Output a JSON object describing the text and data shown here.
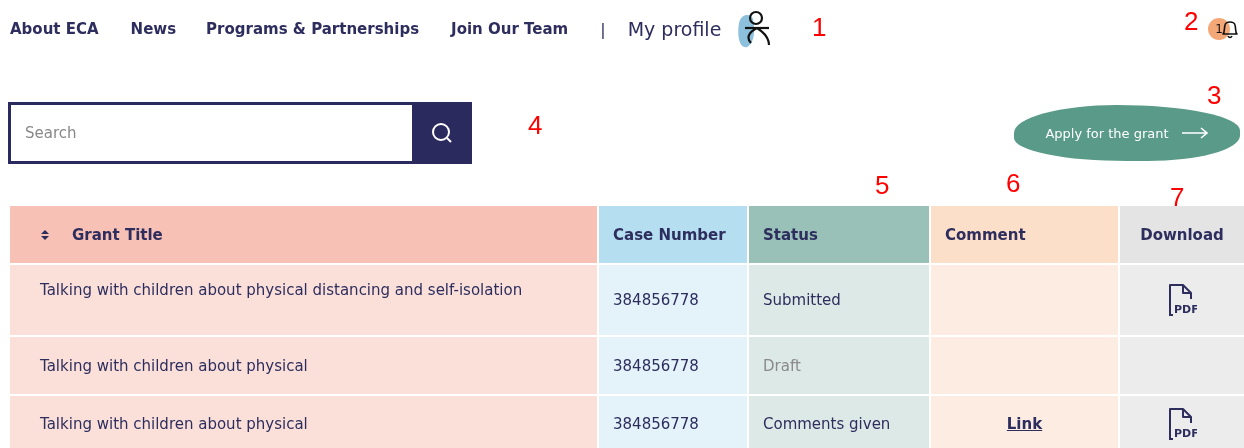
{
  "nav": {
    "links": [
      "About ECA",
      "News",
      "Programs & Partnerships",
      "Join Our Team"
    ],
    "separator": "|",
    "profile": "My profile"
  },
  "notifications": {
    "count": "1"
  },
  "search": {
    "placeholder": "Search"
  },
  "apply_button": {
    "label": "Apply for the grant"
  },
  "table": {
    "columns": [
      "Grant Title",
      "Case Number",
      "Status",
      "Comment",
      "Download"
    ],
    "rows": [
      {
        "title": "Talking with children about physical distancing and self-isolation",
        "case": "384856778",
        "status": "Submitted",
        "dimmed": false,
        "comment": null,
        "download": "PDF"
      },
      {
        "title": "Talking with children about physical",
        "case": "384856778",
        "status": "Draft",
        "dimmed": true,
        "comment": null,
        "download": null
      },
      {
        "title": "Talking with children about physical",
        "case": "384856778",
        "status": "Comments given",
        "dimmed": false,
        "comment": "Link",
        "download": "PDF"
      }
    ]
  },
  "annotations": [
    "1",
    "2",
    "3",
    "4",
    "5",
    "6",
    "7"
  ]
}
